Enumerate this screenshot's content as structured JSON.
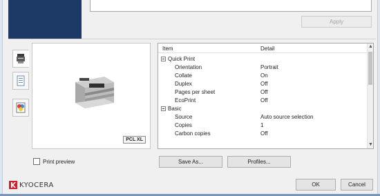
{
  "window": {
    "apply_label": "Apply"
  },
  "side_tabs": [
    {
      "icon": "printer-icon"
    },
    {
      "icon": "document-icon"
    },
    {
      "icon": "color-icon"
    }
  ],
  "preview": {
    "badge": "PCL XL",
    "print_preview_label": "Print preview",
    "print_preview_checked": false
  },
  "tree": {
    "columns": [
      "Item",
      "Detail"
    ],
    "groups": [
      {
        "label": "Quick Print",
        "rows": [
          {
            "item": "Orientation",
            "detail": "Portrait"
          },
          {
            "item": "Collate",
            "detail": "On"
          },
          {
            "item": "Duplex",
            "detail": "Off"
          },
          {
            "item": "Pages per sheet",
            "detail": "Off"
          },
          {
            "item": "EcoPrint",
            "detail": "Off"
          }
        ]
      },
      {
        "label": "Basic",
        "rows": [
          {
            "item": "Source",
            "detail": "Auto source selection"
          },
          {
            "item": "Copies",
            "detail": "1"
          },
          {
            "item": "Carbon copies",
            "detail": "Off"
          }
        ]
      }
    ]
  },
  "buttons": {
    "save_as": "Save As...",
    "profiles": "Profiles...",
    "ok": "OK",
    "cancel": "Cancel"
  },
  "brand": {
    "name": "KYOCERA",
    "color": "#d0202a"
  }
}
